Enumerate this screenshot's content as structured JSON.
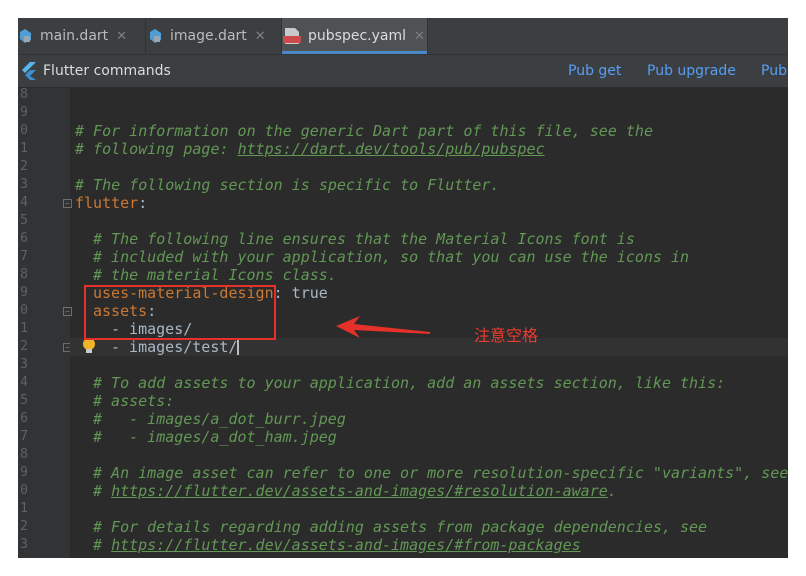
{
  "tabs": [
    {
      "label": "main.dart",
      "icon": "dart-file-icon",
      "active": false
    },
    {
      "label": "image.dart",
      "icon": "dart-file-icon",
      "active": false
    },
    {
      "label": "pubspec.yaml",
      "icon": "yaml-file-icon",
      "active": true
    }
  ],
  "tab_close_glyph": "✕",
  "yaml_badge": "YML",
  "notification": {
    "title": "Flutter commands",
    "actions": [
      "Pub get",
      "Pub upgrade",
      "Pub"
    ]
  },
  "gutter": {
    "line_numbers": [
      "8",
      "9",
      "0",
      "1",
      "2",
      "3",
      "4",
      "5",
      "6",
      "7",
      "8",
      "9",
      "0",
      "1",
      "2",
      "3",
      "4",
      "5",
      "6",
      "7",
      "8",
      "9",
      "0",
      "1",
      "2",
      "3"
    ]
  },
  "code": {
    "l09": "# For information on the generic Dart part of this file, see the",
    "l10a": "# following page: ",
    "l10b": "https://dart.dev/tools/pub/pubspec",
    "l12": "# The following section is specific to Flutter.",
    "l13k": "flutter",
    "colon": ":",
    "l15": "# The following line ensures that the Material Icons font is",
    "l16": "# included with your application, so that you can use the icons in",
    "l17": "# the material Icons class.",
    "l18k": "uses-material-design",
    "l18v": " true",
    "l19k": "assets",
    "l20": "- images/",
    "l21": "- images/test/",
    "l23": "# To add assets to your application, add an assets section, like this:",
    "l24": "# assets:",
    "l25": "#   - images/a_dot_burr.jpeg",
    "l26": "#   - images/a_dot_ham.jpeg",
    "l28": "# An image asset can refer to one or more resolution-specific \"variants\", see",
    "l29a": "# ",
    "l29b": "https://flutter.dev/assets-and-images/#resolution-aware",
    "l29c": ".",
    "l31": "# For details regarding adding assets from package dependencies, see",
    "l32a": "# ",
    "l32b": "https://flutter.dev/assets-and-images/#from-packages"
  },
  "annotation": {
    "note": "注意空格",
    "color": "#e5312a"
  }
}
